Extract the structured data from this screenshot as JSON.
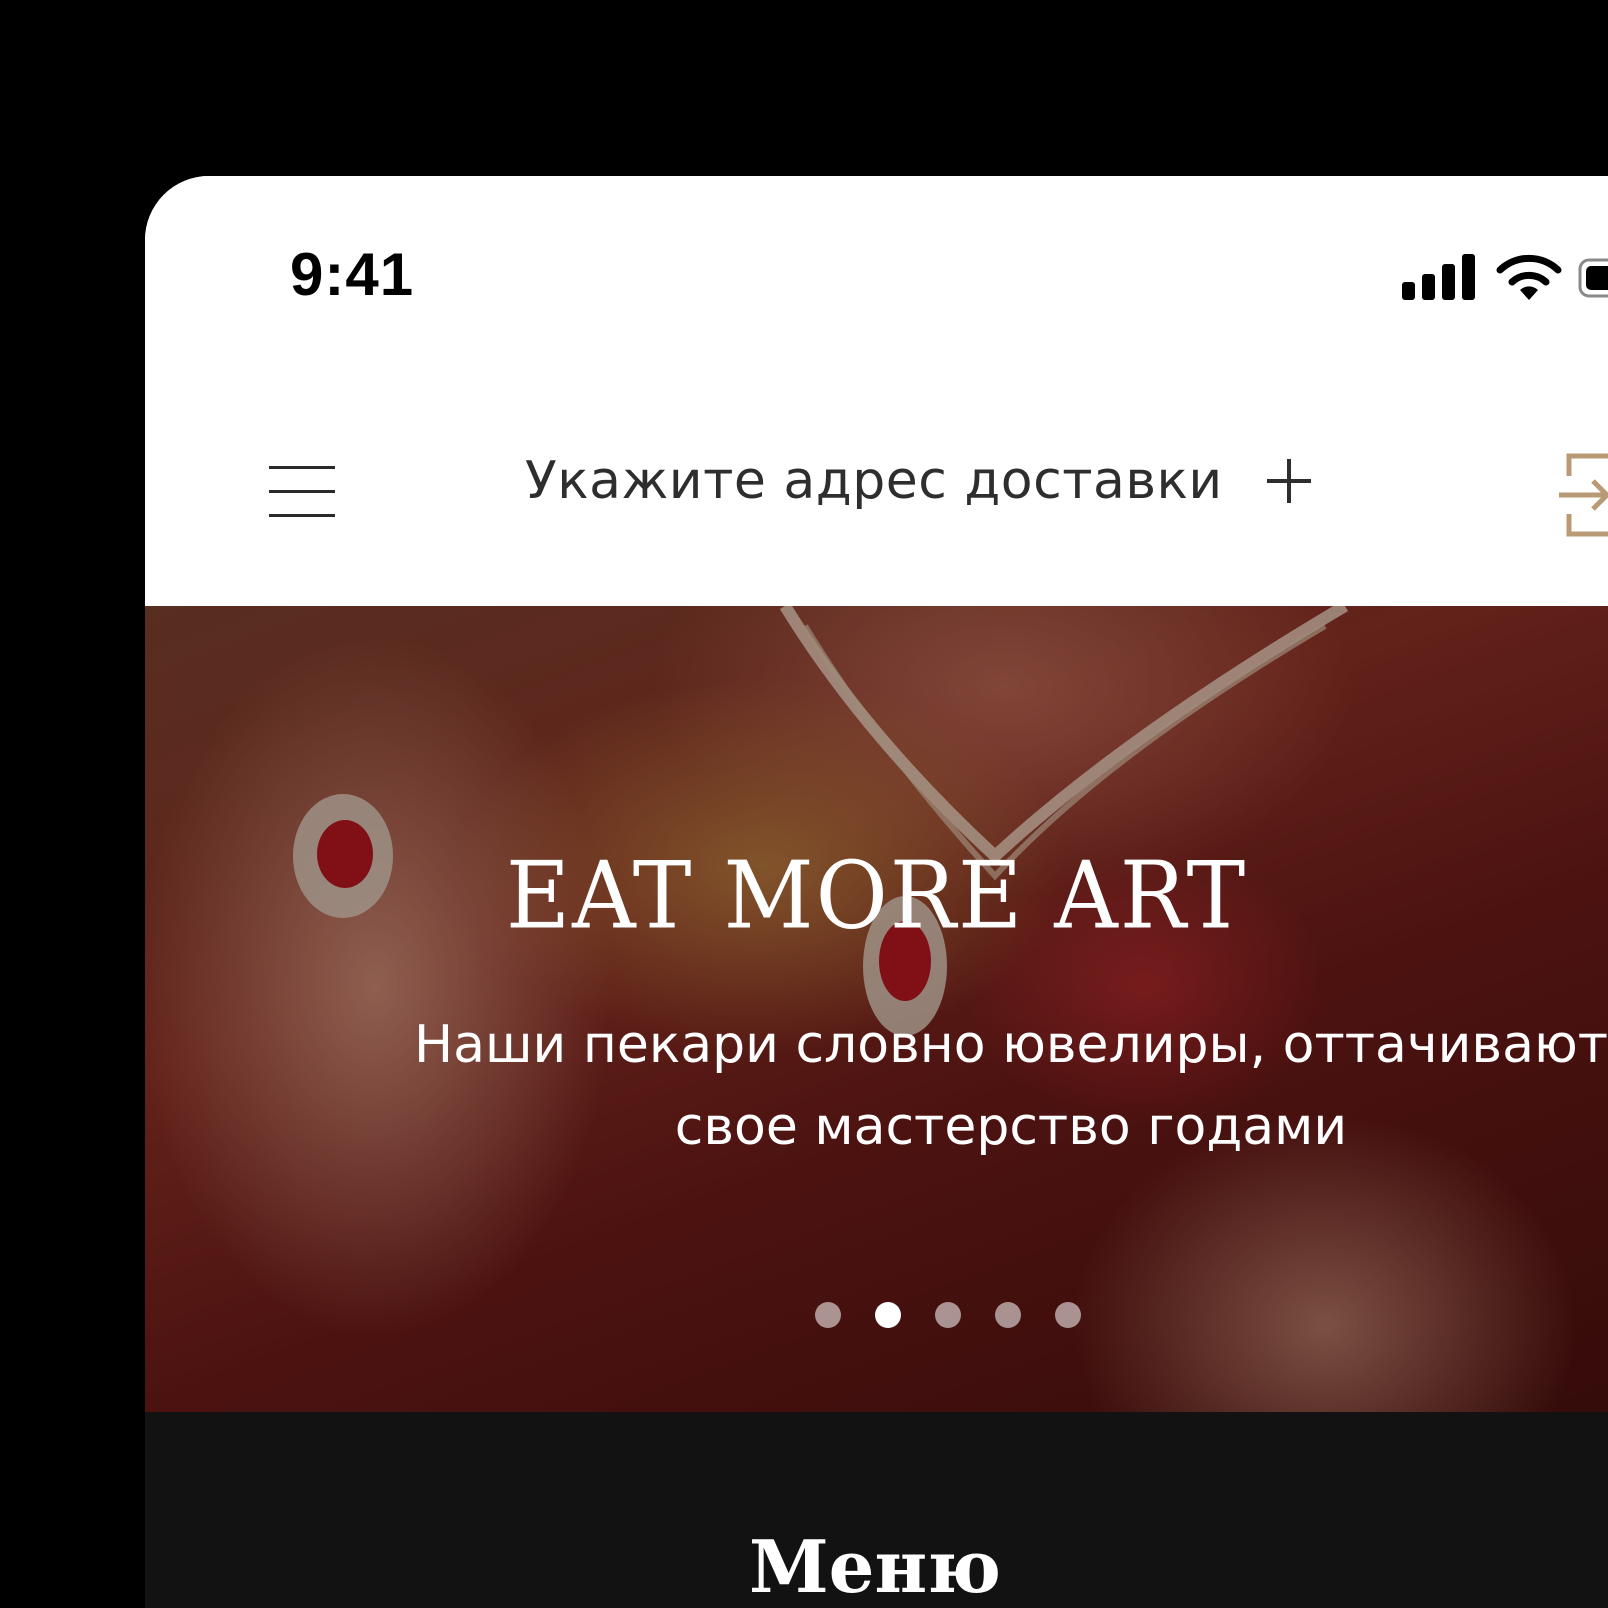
{
  "status_bar": {
    "time": "9:41"
  },
  "header": {
    "address_label": "Укажите адрес доставки",
    "menu_icon": "hamburger-icon",
    "add_icon": "plus-icon",
    "login_icon": "login-icon"
  },
  "hero": {
    "title": "EAT MORE ART",
    "subtitle_line1": "Наши пекари словно ювелиры, оттачивают",
    "subtitle_line2": "свое мастерство годами",
    "slides_total": 5,
    "active_slide": 2
  },
  "menu": {
    "heading": "Меню"
  },
  "colors": {
    "accent": "#b89a74",
    "dark": "#121212",
    "text": "#2e2e2e"
  }
}
